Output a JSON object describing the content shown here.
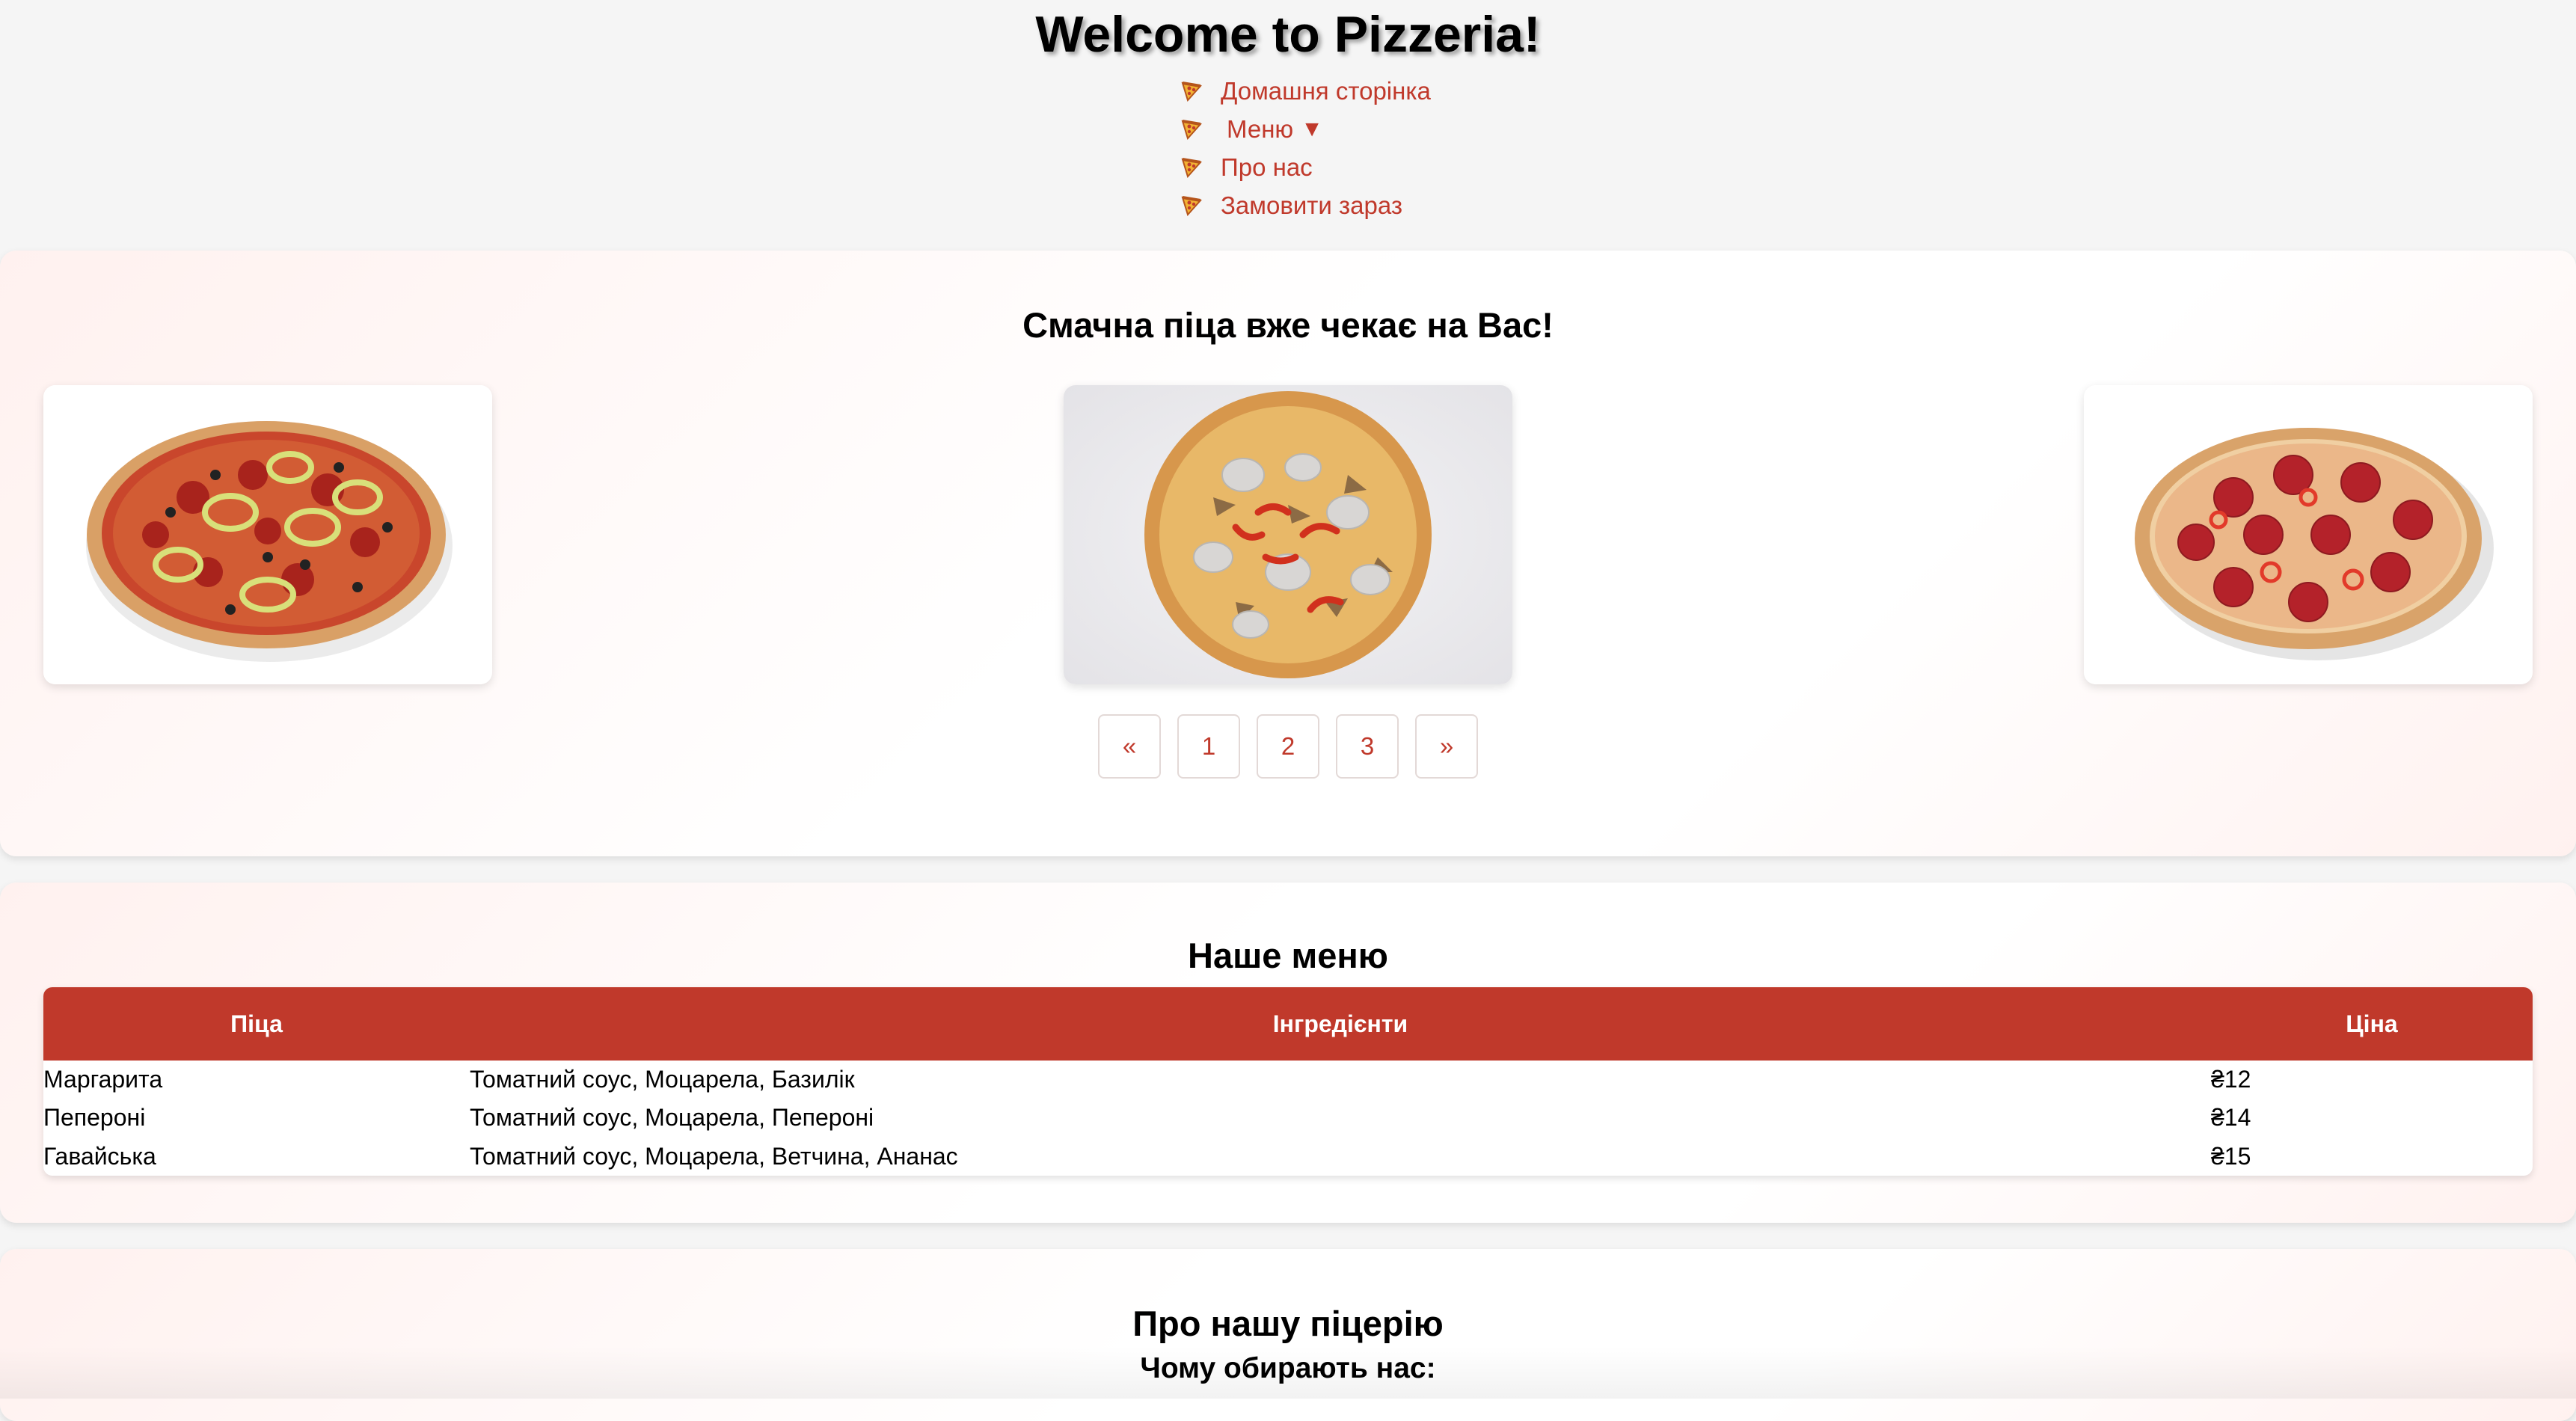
{
  "header": {
    "title": "Welcome to Pizzeria!",
    "nav": [
      {
        "label": "Домашня сторінка",
        "icon": "pizza-icon"
      },
      {
        "label": "Меню",
        "icon": "pizza-icon",
        "caret": "▼"
      },
      {
        "label": "Про нас",
        "icon": "pizza-icon"
      },
      {
        "label": "Замовити зараз",
        "icon": "pizza-icon"
      }
    ]
  },
  "carousel": {
    "title": "Смачна піца вже чекає на Вас!",
    "slides": [
      "pizza-vegetable-image",
      "pizza-mushroom-image",
      "pizza-pepperoni-image"
    ],
    "pagination": {
      "prev": "«",
      "pages": [
        "1",
        "2",
        "3"
      ],
      "next": "»"
    }
  },
  "menu": {
    "title": "Наше меню",
    "columns": [
      "Піца",
      "Інгредієнти",
      "Ціна"
    ],
    "rows": [
      {
        "name": "Маргарита",
        "ingredients": "Томатний соус, Моцарела, Базилік",
        "price": "₴12"
      },
      {
        "name": "Пепероні",
        "ingredients": "Томатний соус, Моцарела, Пепероні",
        "price": "₴14"
      },
      {
        "name": "Гавайська",
        "ingredients": "Томатний соус, Моцарела, Ветчина, Ананас",
        "price": "₴15"
      }
    ]
  },
  "about": {
    "title": "Про нашу піцерію",
    "subtitle": "Чому обирають нас:"
  },
  "colors": {
    "accent": "#c0392b",
    "background": "#f5f5f5"
  }
}
